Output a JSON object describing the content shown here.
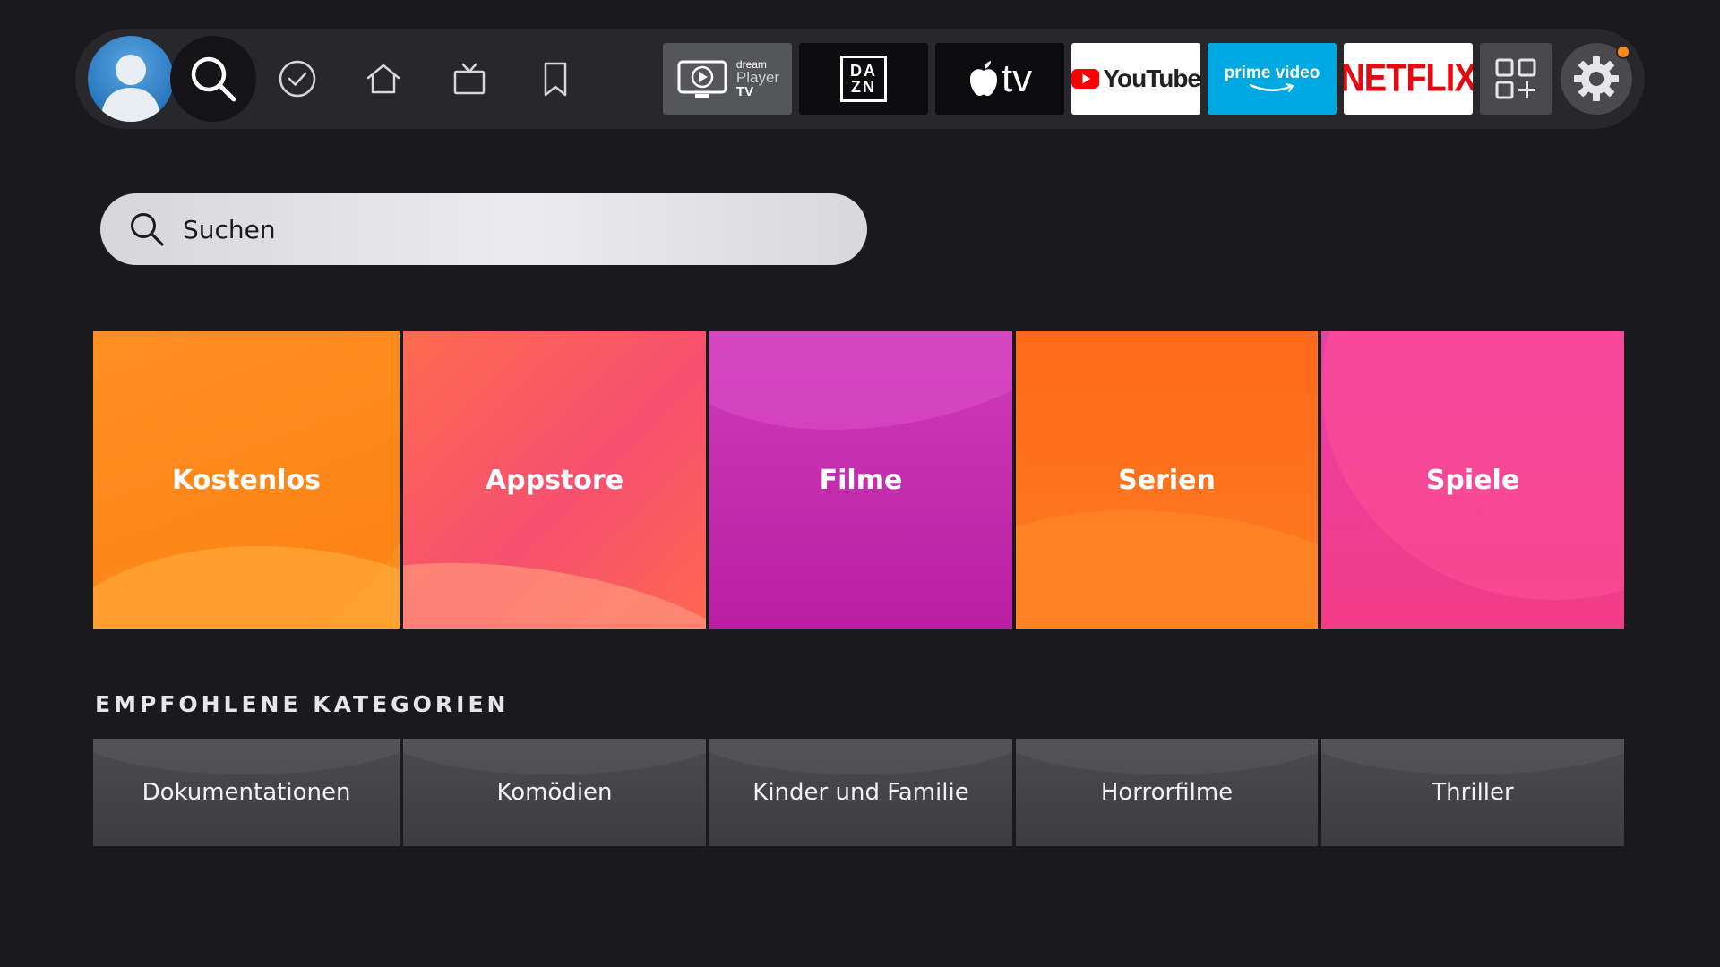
{
  "nav": {
    "icons": [
      "avatar-icon",
      "search-icon",
      "check-circle-icon",
      "home-icon",
      "live-tv-icon",
      "bookmark-icon"
    ],
    "apps": {
      "dreamplayer": {
        "line1": "dream",
        "line2": "Player",
        "line3": "TV"
      },
      "dazn": {
        "line1": "DA",
        "line2": "ZN"
      },
      "appletv": {
        "label": "tv"
      },
      "youtube": {
        "label": "YouTube",
        "color": "#ff0000"
      },
      "prime": {
        "label": "prime video",
        "color": "#00a8e1"
      },
      "netflix": {
        "label": "NETFLIX",
        "color": "#e50914"
      }
    },
    "settings_icon": "gear-icon",
    "notification_color": "#ff8a1f"
  },
  "search": {
    "placeholder": "Suchen"
  },
  "categories": [
    {
      "label": "Kostenlos",
      "color": "#ff9a2e"
    },
    {
      "label": "Appstore",
      "color": "#f5506f"
    },
    {
      "label": "Filme",
      "color": "#c42aae"
    },
    {
      "label": "Serien",
      "color": "#ff6a1a"
    },
    {
      "label": "Spiele",
      "color": "#ec3f98"
    }
  ],
  "recommended": {
    "title": "EMPFOHLENE KATEGORIEN",
    "items": [
      {
        "label": "Dokumentationen"
      },
      {
        "label": "Komödien"
      },
      {
        "label": "Kinder und Familie"
      },
      {
        "label": "Horrorfilme"
      },
      {
        "label": "Thriller"
      }
    ]
  }
}
